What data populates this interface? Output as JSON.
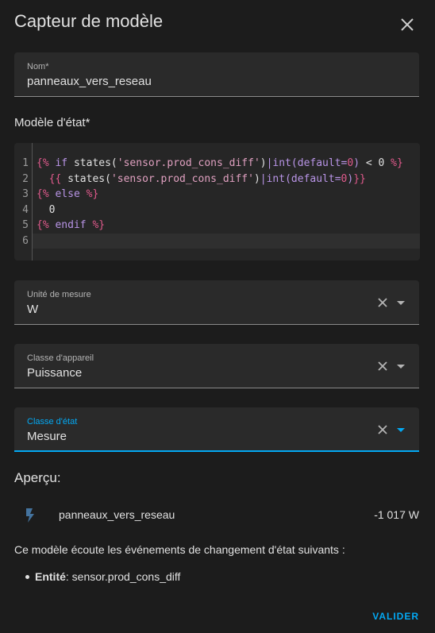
{
  "dialog": {
    "title": "Capteur de modèle",
    "close_icon": "close-icon"
  },
  "name_field": {
    "label": "Nom*",
    "value": "panneaux_vers_reseau"
  },
  "template": {
    "label": "Modèle d'état*",
    "line_numbers": [
      "1",
      "2",
      "3",
      "4",
      "5",
      "6"
    ],
    "lines": [
      "{% if states('sensor.prod_cons_diff')|int(default=0) < 0 %}",
      "  {{ states('sensor.prod_cons_diff')|int(default=0)}}",
      "{% else %}",
      "  0",
      "{% endif %}",
      ""
    ]
  },
  "unit_field": {
    "label": "Unité de mesure",
    "value": "W"
  },
  "device_class_field": {
    "label": "Classe d'appareil",
    "value": "Puissance"
  },
  "state_class_field": {
    "label": "Classe d'état",
    "value": "Mesure"
  },
  "preview": {
    "title": "Aperçu:",
    "icon": "flash-icon",
    "entity_name": "panneaux_vers_reseau",
    "value": "-1 017 W"
  },
  "listening": {
    "text": "Ce modèle écoute les événements de changement d'état suivants :",
    "items": [
      {
        "label": "Entité",
        "separator": ":",
        "value": "sensor.prod_cons_diff"
      }
    ]
  },
  "actions": {
    "validate_label": "VALIDER"
  },
  "colors": {
    "accent": "#03a9f4",
    "background": "#1c1c1c",
    "field_bg": "#2a2a2a"
  }
}
